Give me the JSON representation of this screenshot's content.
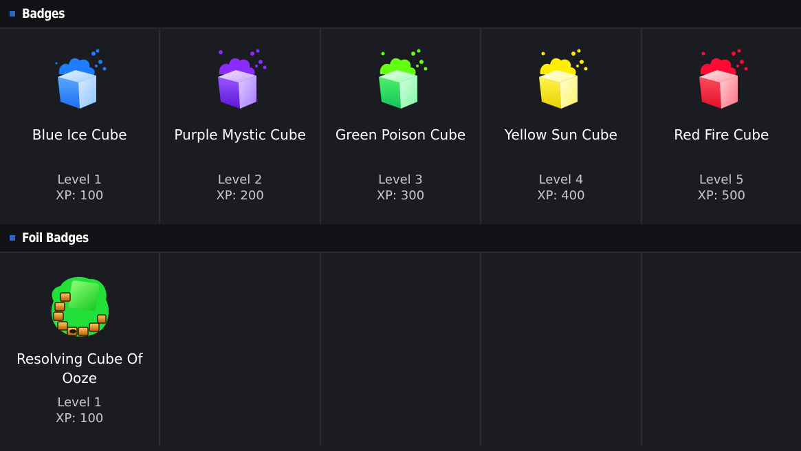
{
  "sections": [
    {
      "title": "Badges",
      "cards": [
        {
          "name": "Blue Ice Cube",
          "level": "Level 1",
          "xp": "XP: 100",
          "icon": "blue-cube-icon",
          "color": "#3a8cff"
        },
        {
          "name": "Purple Mystic Cube",
          "level": "Level 2",
          "xp": "XP: 200",
          "icon": "purple-cube-icon",
          "color": "#8a3cff"
        },
        {
          "name": "Green Poison Cube",
          "level": "Level 3",
          "xp": "XP: 300",
          "icon": "green-cube-icon",
          "color": "#5cff2a"
        },
        {
          "name": "Yellow Sun Cube",
          "level": "Level 4",
          "xp": "XP: 400",
          "icon": "yellow-cube-icon",
          "color": "#ffee10"
        },
        {
          "name": "Red Fire Cube",
          "level": "Level 5",
          "xp": "XP: 500",
          "icon": "red-cube-icon",
          "color": "#ff1a3a"
        }
      ]
    },
    {
      "title": "Foil Badges",
      "cards": [
        {
          "name": "Resolving Cube Of Ooze",
          "level": "Level 1",
          "xp": "XP: 100",
          "icon": "ooze-cube-icon",
          "color": "#22e83a"
        }
      ]
    }
  ],
  "colors": {
    "background": "#1a1b1f",
    "header": "#111216",
    "accent": "#2a66c8"
  }
}
